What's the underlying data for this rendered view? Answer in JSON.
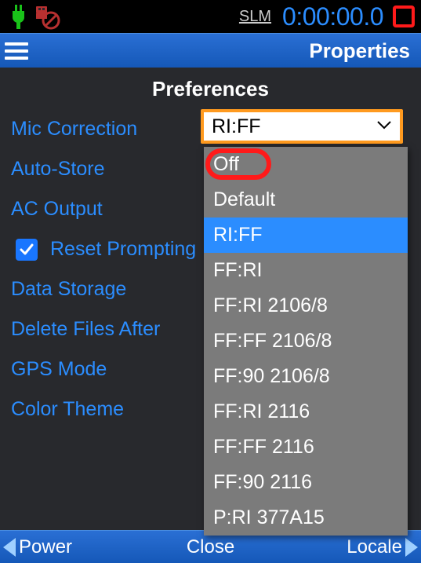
{
  "status": {
    "mode": "SLM",
    "timer": "0:00:00.0"
  },
  "titlebar": {
    "title": "Properties"
  },
  "section_heading": "Preferences",
  "labels": {
    "mic_correction": "Mic Correction",
    "auto_store": "Auto-Store",
    "ac_output": "AC Output",
    "reset_prompting": "Reset Prompting",
    "data_storage": "Data Storage",
    "delete_files_after": "Delete Files After",
    "gps_mode": "GPS Mode",
    "color_theme": "Color Theme"
  },
  "mic_correction_select": {
    "value": "RI:FF",
    "options": [
      "Off",
      "Default",
      "RI:FF",
      "FF:RI",
      "FF:RI 2106/8",
      "FF:FF 2106/8",
      "FF:90 2106/8",
      "FF:RI 2116",
      "FF:FF 2116",
      "FF:90 2116",
      "P:RI 377A15"
    ],
    "selected_index": 2,
    "annotated_index": 0
  },
  "reset_prompting_checked": true,
  "bottom": {
    "left": "Power",
    "center": "Close",
    "right": "Locale"
  }
}
